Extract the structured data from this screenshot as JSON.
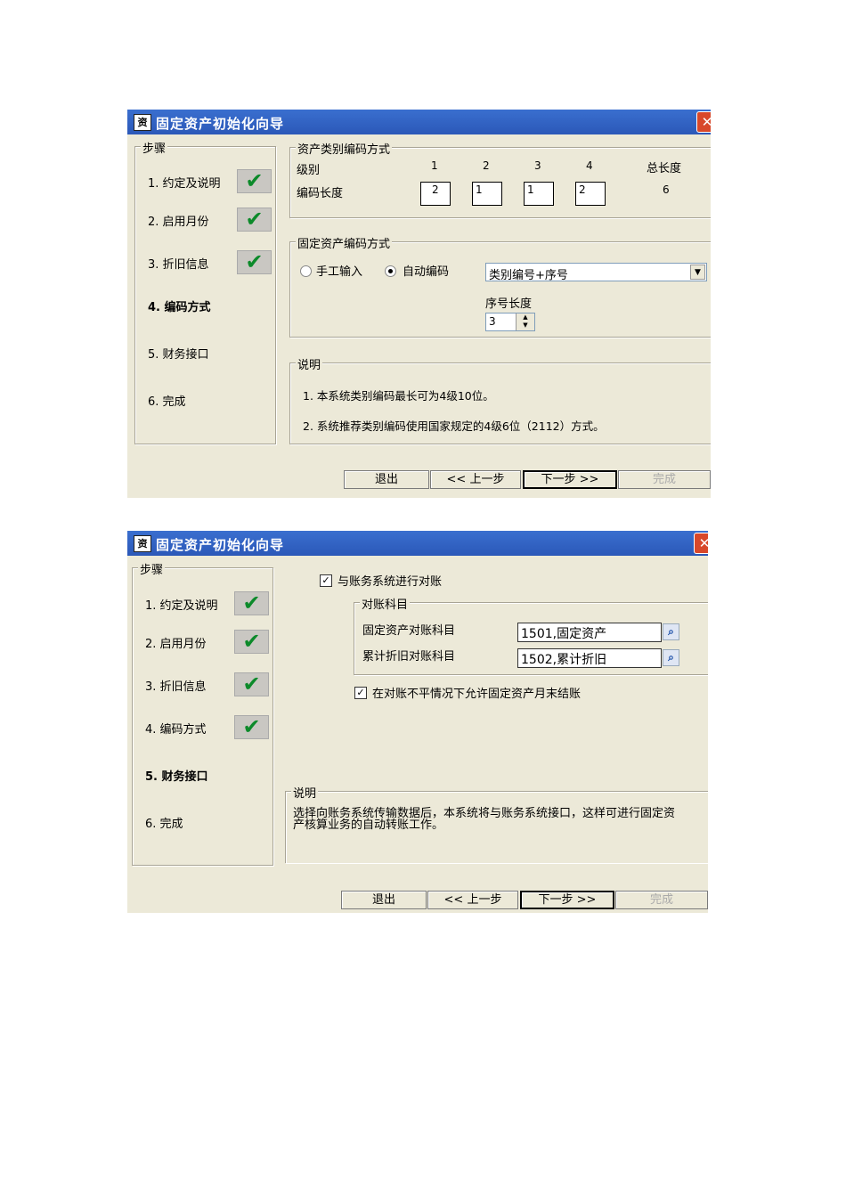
{
  "dialog1": {
    "title": "固定资产初始化向导",
    "steps_title": "步骤",
    "steps": [
      {
        "label": "1. 约定及说明",
        "done": true
      },
      {
        "label": "2. 启用月份",
        "done": true
      },
      {
        "label": "3. 折旧信息",
        "done": true
      },
      {
        "label": "4. 编码方式",
        "done": false,
        "current": true
      },
      {
        "label": "5. 财务接口",
        "done": false
      },
      {
        "label": "6. 完成",
        "done": false
      }
    ],
    "category_coding": {
      "title": "资产类别编码方式",
      "level_label": "级别",
      "code_length_label": "编码长度",
      "levels": [
        "1",
        "2",
        "3",
        "4"
      ],
      "lengths": [
        "2",
        "1",
        "1",
        "2"
      ],
      "total_label": "总长度",
      "total_value": "6"
    },
    "asset_coding": {
      "title": "固定资产编码方式",
      "manual_label": "手工输入",
      "auto_label": "自动编码",
      "selected": "auto",
      "scheme_value": "类别编号+序号",
      "serial_length_label": "序号长度",
      "serial_length_value": "3"
    },
    "notes": {
      "title": "说明",
      "line1": "1. 本系统类别编码最长可为4级10位。",
      "line2": "2. 系统推荐类别编码使用国家规定的4级6位（2112）方式。"
    },
    "buttons": {
      "exit": "退出",
      "prev": "<< 上一步",
      "next": "下一步 >>",
      "finish": "完成"
    }
  },
  "dialog2": {
    "title": "固定资产初始化向导",
    "steps_title": "步骤",
    "steps": [
      {
        "label": "1. 约定及说明",
        "done": true
      },
      {
        "label": "2. 启用月份",
        "done": true
      },
      {
        "label": "3. 折旧信息",
        "done": true
      },
      {
        "label": "4. 编码方式",
        "done": true
      },
      {
        "label": "5. 财务接口",
        "done": false,
        "current": true
      },
      {
        "label": "6. 完成",
        "done": false
      }
    ],
    "reconcile_check_label": "与账务系统进行对账",
    "reconcile_checked": true,
    "accounts": {
      "title": "对账科目",
      "fixed_asset_label": "固定资产对账科目",
      "fixed_asset_value": "1501,固定资产",
      "depreciation_label": "累计折旧对账科目",
      "depreciation_value": "1502,累计折旧"
    },
    "allow_close_label": "在对账不平情况下允许固定资产月末结账",
    "allow_close_checked": true,
    "notes": {
      "title": "说明",
      "line1": "选择向账务系统传输数据后，本系统将与账务系统接口，这样可进行固定资",
      "line2": "产核算业务的自动转账工作。"
    },
    "buttons": {
      "exit": "退出",
      "prev": "<< 上一步",
      "next": "下一步 >>",
      "finish": "完成"
    }
  },
  "icons": {
    "check_glyph": "✔",
    "close_glyph": "✕",
    "search_glyph": "🔍"
  }
}
